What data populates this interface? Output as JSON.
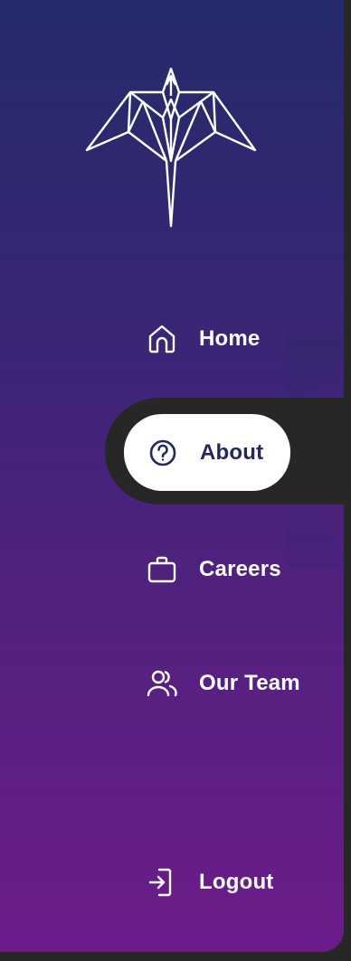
{
  "brand": {
    "logo": "origami-dragon-logo"
  },
  "nav": {
    "items": [
      {
        "label": "Home",
        "icon": "home-icon",
        "active": false
      },
      {
        "label": "About",
        "icon": "question-circle-icon",
        "active": true
      },
      {
        "label": "Careers",
        "icon": "briefcase-icon",
        "active": false
      },
      {
        "label": "Our Team",
        "icon": "people-icon",
        "active": false
      }
    ],
    "logout": {
      "label": "Logout",
      "icon": "logout-icon"
    }
  },
  "colors": {
    "gradient_top": "#242b6a",
    "gradient_bottom": "#6c1c8a",
    "active_bg": "#ffffff",
    "active_text": "#23285e",
    "text": "#ffffff",
    "background": "#272727"
  }
}
